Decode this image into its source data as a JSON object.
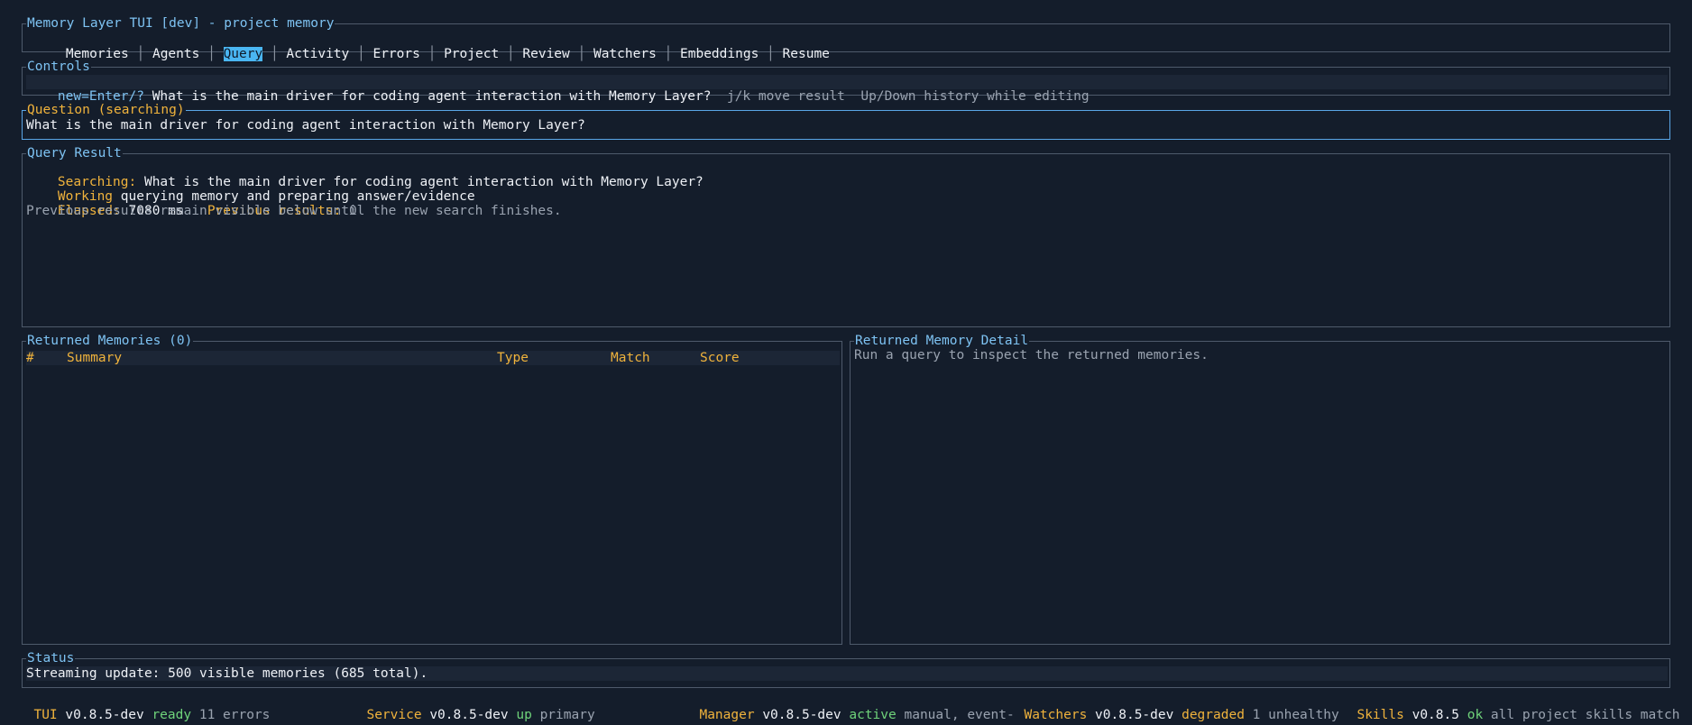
{
  "window": {
    "title": "Memory Layer TUI [dev] - project memory",
    "tabs": [
      "Memories",
      "Agents",
      "Query",
      "Activity",
      "Errors",
      "Project",
      "Review",
      "Watchers",
      "Embeddings",
      "Resume"
    ],
    "selected_tab": "Query"
  },
  "controls": {
    "title": "Controls",
    "key_hint": "new=Enter/?",
    "query_text": "What is the main driver for coding agent interaction with Memory Layer?",
    "hint_move": "j/k move result",
    "hint_history": "Up/Down history while editing"
  },
  "question": {
    "title": "Question (searching)",
    "text": "What is the main driver for coding agent interaction with Memory Layer?"
  },
  "query_result": {
    "title": "Query Result",
    "searching_label": "Searching:",
    "searching_text": "What is the main driver for coding agent interaction with Memory Layer?",
    "working_label": "Working",
    "working_text": "querying memory and preparing answer/evidence",
    "elapsed_label": "Elapsed:",
    "elapsed_value": "7080 ms",
    "previous_label": "Previous results:",
    "previous_value": "0",
    "note": "Previous results remain visible below until the new search finishes."
  },
  "returned_memories": {
    "title": "Returned Memories (0)",
    "columns": [
      "#",
      "Summary",
      "Type",
      "Match",
      "Score"
    ],
    "rows": []
  },
  "memory_detail": {
    "title": "Returned Memory Detail",
    "text": "Run a query to inspect the returned memories."
  },
  "status": {
    "title": "Status",
    "text": "Streaming update: 500 visible memories (685 total)."
  },
  "footer": {
    "tui": {
      "label": "TUI",
      "version": "v0.8.5-dev",
      "state": "ready",
      "detail": "11 errors"
    },
    "service": {
      "label": "Service",
      "version": "v0.8.5-dev",
      "state": "up",
      "detail": "primary"
    },
    "manager": {
      "label": "Manager",
      "version": "v0.8.5-dev",
      "state": "active",
      "detail": "manual, event-"
    },
    "watchers": {
      "label": "Watchers",
      "version": "v0.8.5-dev",
      "state": "degraded",
      "detail": "1 unhealthy"
    },
    "skills": {
      "label": "Skills",
      "version": "v0.8.5",
      "state": "ok",
      "detail": "all project skills match"
    }
  },
  "colors": {
    "background": "#141d2b",
    "accent": "#4ab6f2",
    "label": "#f0b33c",
    "ok": "#6fd37a",
    "border": "#4e5a6b"
  }
}
